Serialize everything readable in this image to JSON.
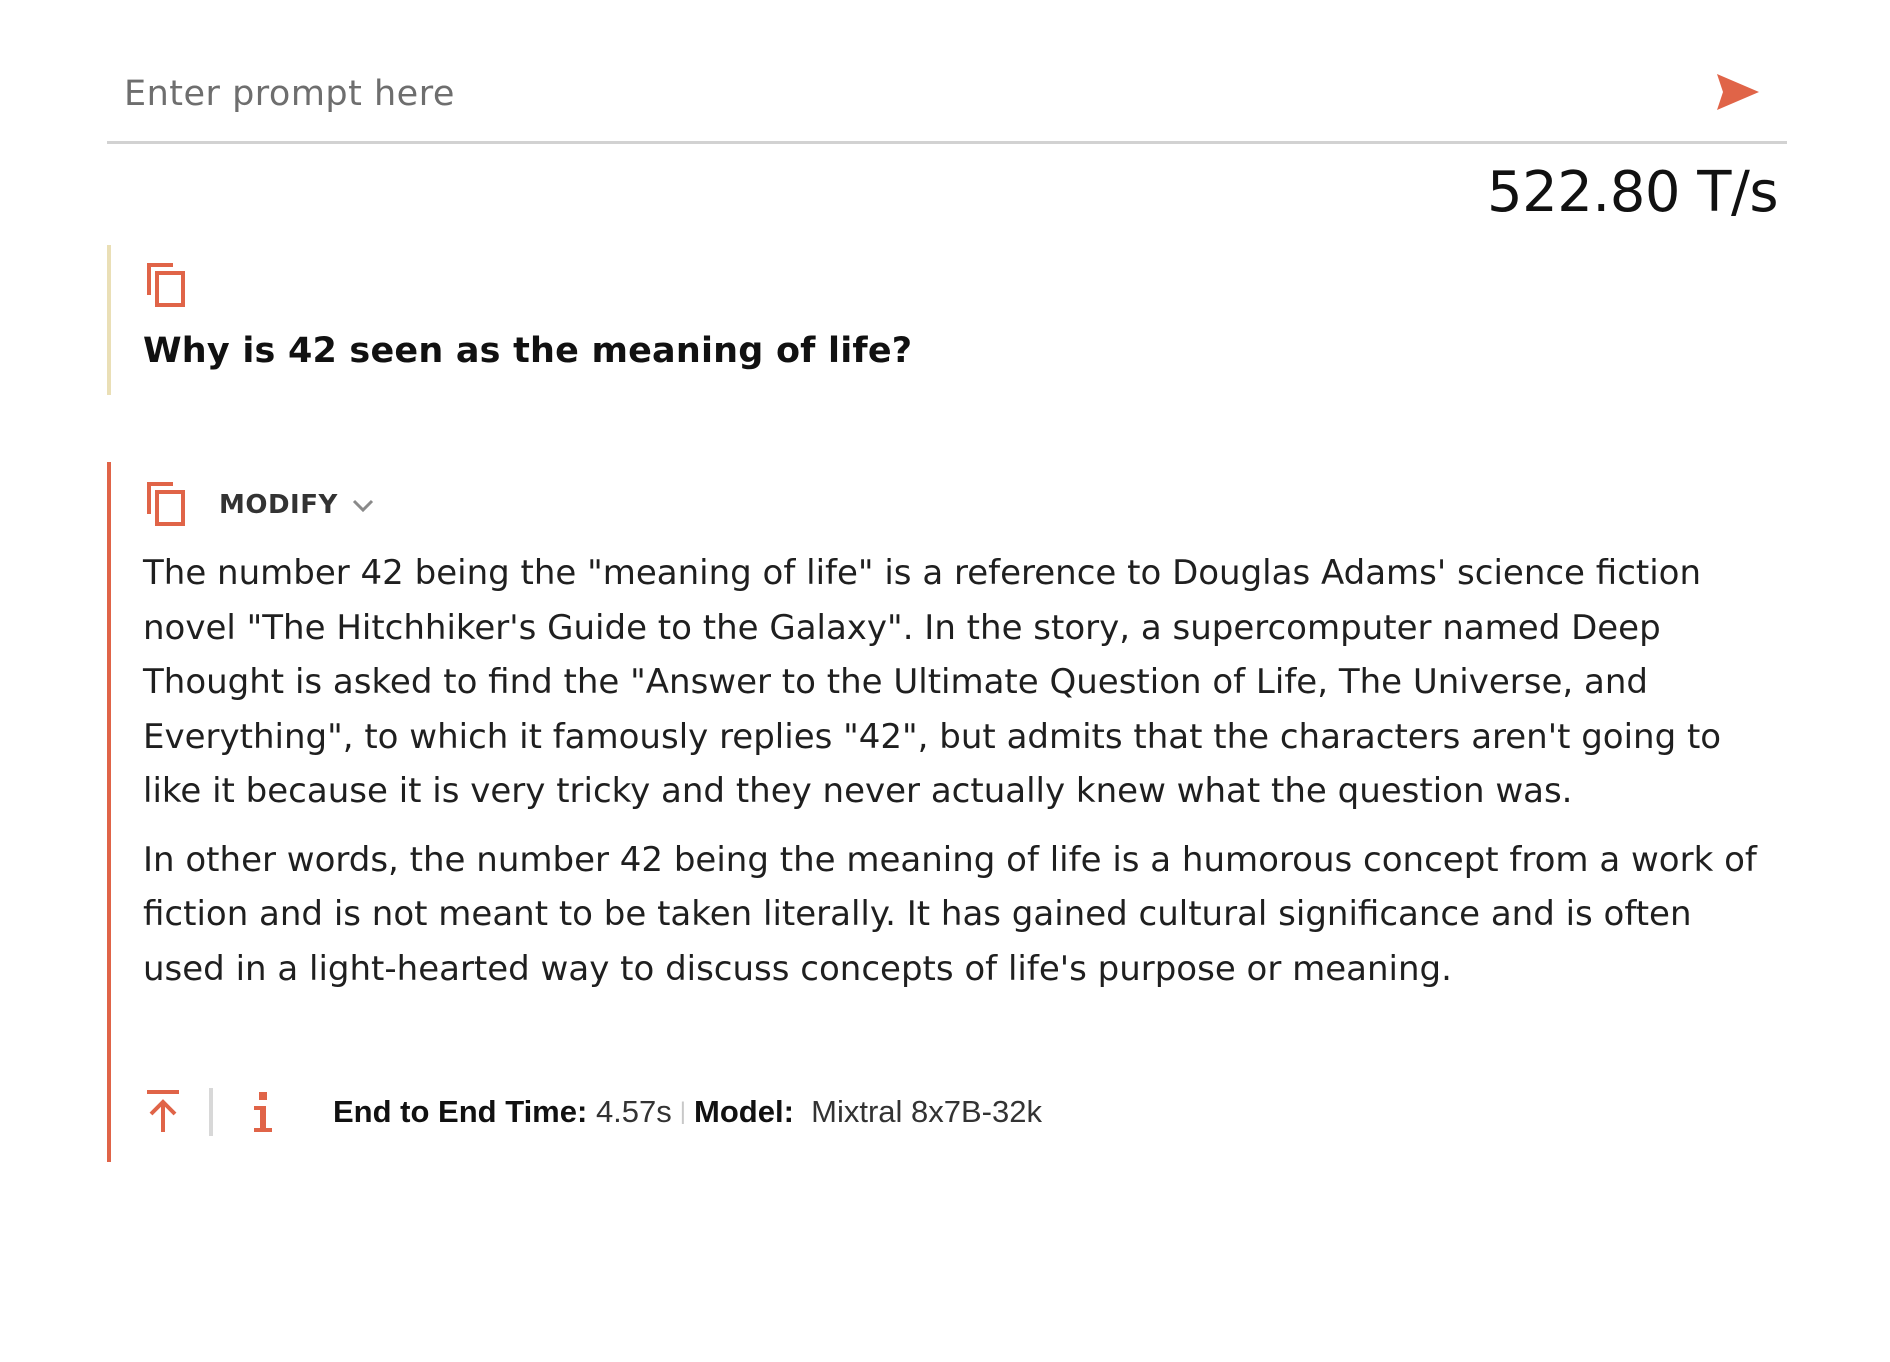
{
  "prompt": {
    "placeholder": "Enter prompt here",
    "send_icon": "send-arrow-icon"
  },
  "throughput": "522.80 T/s",
  "question": {
    "copy_icon": "copy-icon",
    "text": "Why is 42 seen as the meaning of life?"
  },
  "answer": {
    "copy_icon": "copy-icon",
    "modify_label": "MODIFY",
    "paragraphs": [
      "The number 42 being the \"meaning of life\" is a reference to Douglas Adams' science fiction novel \"The Hitchhiker's Guide to the Galaxy\". In the story, a supercomputer named Deep Thought is asked to find the \"Answer to the Ultimate Question of Life, The Universe, and Everything\", to which it famously replies \"42\", but admits that the characters aren't going to like it because it is very tricky and they never actually knew what the question was.",
      "In other words, the number 42 being the meaning of life is a humorous concept from a work of fiction and is not meant to be taken literally. It has gained cultural significance and is often used in a light-hearted way to discuss concepts of life's purpose or meaning."
    ],
    "footer": {
      "time_label": "End to End Time:",
      "time_value": "4.57s",
      "separator": "|",
      "model_label": "Model:",
      "model_value": "Mixtral 8x7B-32k"
    }
  },
  "colors": {
    "accent": "#e06448",
    "question_border": "#eadfb6",
    "divider": "#d2d2d2"
  }
}
